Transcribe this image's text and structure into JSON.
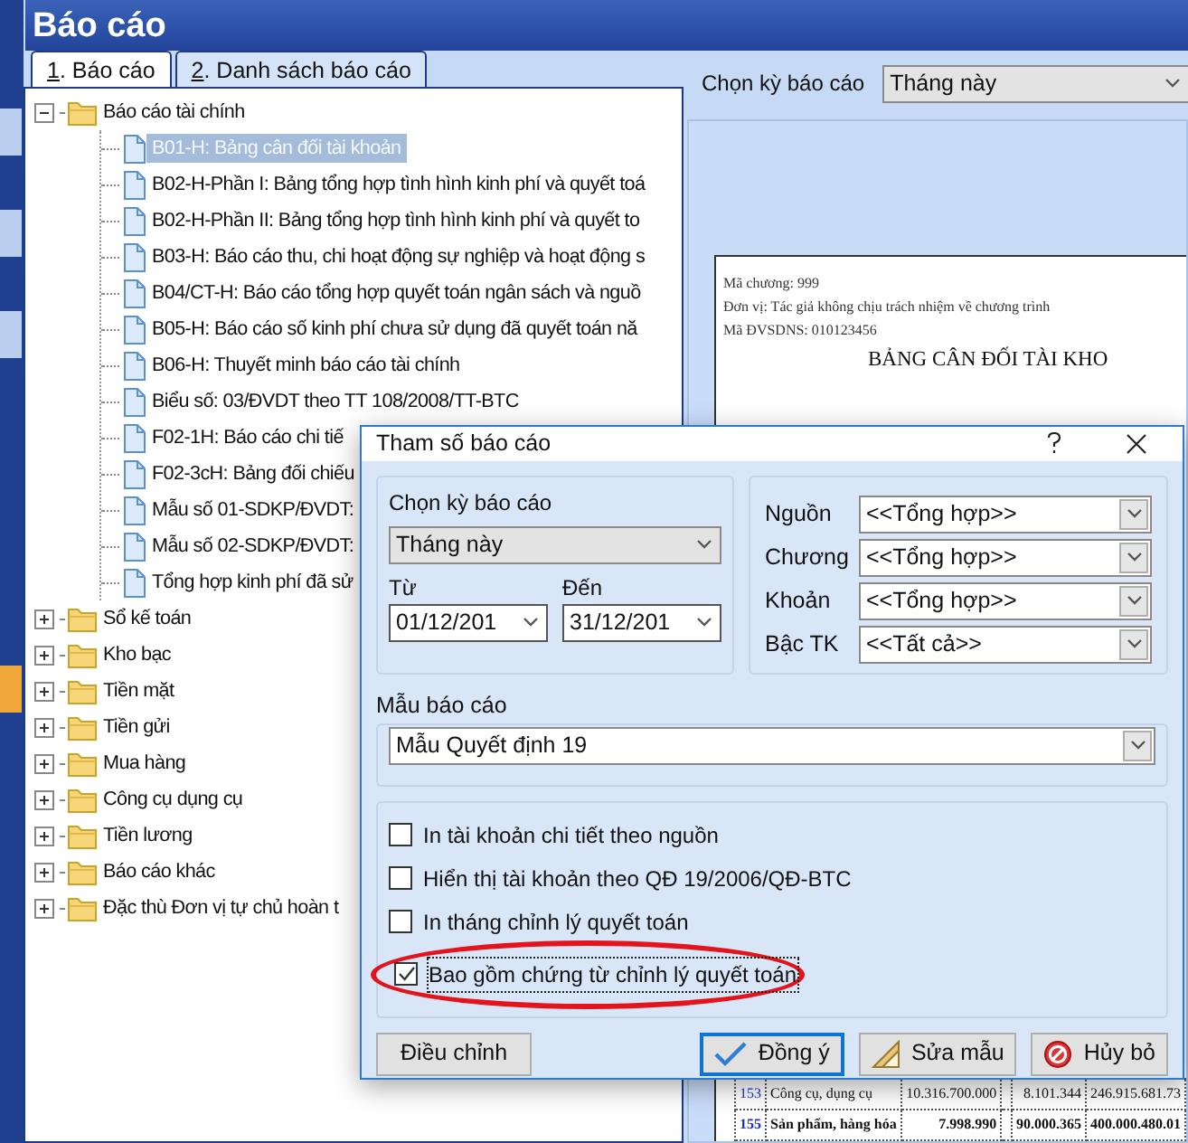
{
  "window": {
    "title": "Báo cáo"
  },
  "tabs": [
    {
      "label": "1. Báo cáo",
      "selected": true
    },
    {
      "label": "2. Danh sách báo cáo",
      "selected": false
    }
  ],
  "tree": [
    {
      "label": "Báo cáo tài chính",
      "kind": "folder",
      "expanded": true,
      "selected": false,
      "children": [
        {
          "label": "B01-H: Bảng cân đối tài khoản",
          "kind": "report",
          "selected": true
        },
        {
          "label": "B02-H-Phần I: Bảng tổng hợp tình hình kinh phí và quyết toá",
          "kind": "report",
          "selected": false
        },
        {
          "label": "B02-H-Phần II: Bảng tổng hợp tình hình kinh phí và quyết to",
          "kind": "report",
          "selected": false
        },
        {
          "label": "B03-H: Báo cáo thu, chi hoạt động sự nghiệp và hoạt động s",
          "kind": "report",
          "selected": false
        },
        {
          "label": "B04/CT-H: Báo cáo tổng hợp quyết toán ngân sách và nguồ",
          "kind": "report",
          "selected": false
        },
        {
          "label": "B05-H: Báo cáo số kinh phí chưa sử dụng đã quyết toán nă",
          "kind": "report",
          "selected": false
        },
        {
          "label": "B06-H: Thuyết minh báo cáo tài chính",
          "kind": "report",
          "selected": false
        },
        {
          "label": "Biểu số: 03/ĐVDT theo TT 108/2008/TT-BTC",
          "kind": "report",
          "selected": false
        },
        {
          "label": "F02-1H: Báo cáo chi tiế",
          "kind": "report",
          "selected": false
        },
        {
          "label": "F02-3cH: Bảng đối chiếu",
          "kind": "report",
          "selected": false
        },
        {
          "label": "Mẫu số 01-SDKP/ĐVDT:",
          "kind": "report",
          "selected": false
        },
        {
          "label": "Mẫu số 02-SDKP/ĐVDT:",
          "kind": "report",
          "selected": false
        },
        {
          "label": "Tổng hợp kinh phí đã sử",
          "kind": "report",
          "selected": false
        }
      ]
    },
    {
      "label": "Sổ kế toán",
      "kind": "folder",
      "expanded": false,
      "selected": false
    },
    {
      "label": "Kho bạc",
      "kind": "folder",
      "expanded": false,
      "selected": false
    },
    {
      "label": "Tiền mặt",
      "kind": "folder",
      "expanded": false,
      "selected": false
    },
    {
      "label": "Tiền gửi",
      "kind": "folder",
      "expanded": false,
      "selected": false
    },
    {
      "label": "Mua hàng",
      "kind": "folder",
      "expanded": false,
      "selected": false
    },
    {
      "label": "Công cụ dụng cụ",
      "kind": "folder",
      "expanded": false,
      "selected": false
    },
    {
      "label": "Tiền lương",
      "kind": "folder",
      "expanded": false,
      "selected": false
    },
    {
      "label": "Báo cáo khác",
      "kind": "folder",
      "expanded": false,
      "selected": false
    },
    {
      "label": "Đặc thù Đơn vị tự chủ hoàn t",
      "kind": "folder",
      "expanded": false,
      "selected": false
    }
  ],
  "period_bar": {
    "label": "Chọn kỳ báo cáo",
    "value": "Tháng này"
  },
  "preview": {
    "lines": [
      "Mã chương: 999",
      "Đơn vị: Tác giả không chịu trách nhiệm về chương trình",
      "Mã ĐVSDNS: 010123456"
    ],
    "title": "BẢNG CÂN ĐỐI TÀI KHO",
    "rows": [
      {
        "code": "153",
        "name": "Công cụ, dụng cụ",
        "column_3": "10.316.700.000",
        "column_5": "8.101.344",
        "column_6": "246.915.681.73",
        "bold": false
      },
      {
        "code": "155",
        "name": "Sản phẩm, hàng hóa",
        "column_3": "7.998.990",
        "column_5": "90.000.365",
        "column_6": "400.000.480.01",
        "bold": true
      }
    ]
  },
  "dialog": {
    "title": "Tham số báo cáo",
    "period": {
      "label": "Chọn kỳ báo cáo",
      "value": "Tháng này",
      "from_label": "Từ",
      "from": "01/12/201",
      "to_label": "Đến",
      "to": "31/12/201"
    },
    "filters": [
      {
        "label": "Nguồn",
        "value": "<<Tổng hợp>>"
      },
      {
        "label": "Chương",
        "value": "<<Tổng hợp>>"
      },
      {
        "label": "Khoản",
        "value": "<<Tổng hợp>>"
      },
      {
        "label": "Bậc TK",
        "value": "<<Tất cả>>"
      }
    ],
    "template": {
      "label": "Mẫu báo cáo",
      "value": "Mẫu Quyết định 19"
    },
    "options": [
      {
        "label": "In tài khoản chi tiết theo nguồn",
        "checked": false,
        "focused": false
      },
      {
        "label": "Hiển thị tài khoản theo QĐ 19/2006/QĐ-BTC",
        "checked": false,
        "focused": false
      },
      {
        "label": "In tháng chỉnh lý quyết toán",
        "checked": false,
        "focused": false
      },
      {
        "label": "Bao gồm chứng từ chỉnh lý quyết toán",
        "checked": true,
        "focused": true,
        "highlighted": true
      }
    ],
    "buttons": [
      {
        "label": "Điều chỉnh",
        "kind": "plain",
        "focused": false
      },
      {
        "label": "Đồng ý",
        "kind": "ok",
        "focused": true
      },
      {
        "label": "Sửa mẫu",
        "kind": "edit",
        "focused": false
      },
      {
        "label": "Hủy bỏ",
        "kind": "cancel",
        "focused": false
      }
    ]
  }
}
